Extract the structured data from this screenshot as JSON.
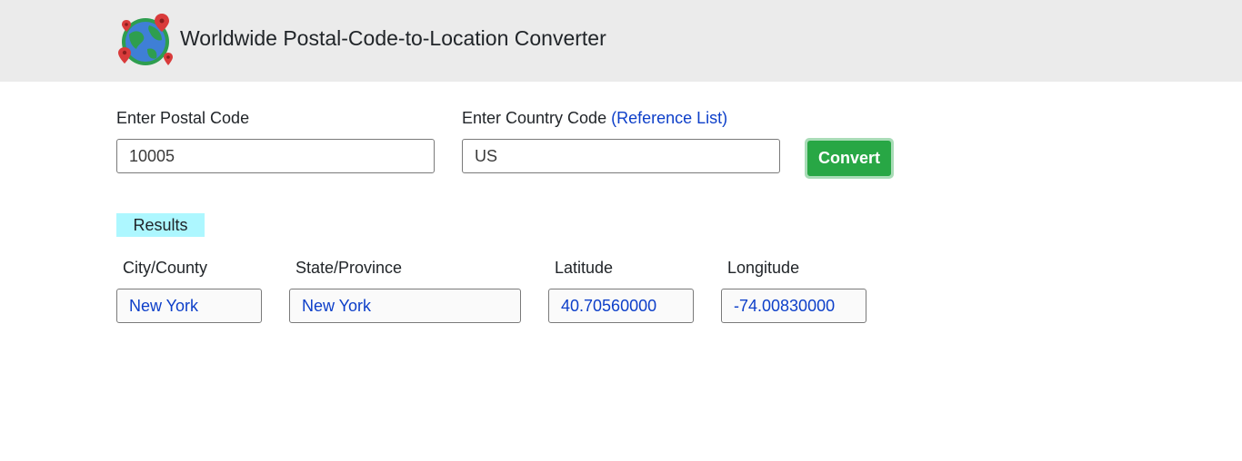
{
  "header": {
    "title": "Worldwide Postal-Code-to-Location Converter",
    "logo_icon": "globe-with-pins-icon"
  },
  "form": {
    "postal_code_label": "Enter Postal Code",
    "postal_code_value": "10005",
    "country_code_label": "Enter Country Code",
    "reference_link": "(Reference List)",
    "country_code_value": "US",
    "convert_button": "Convert"
  },
  "results": {
    "badge": "Results",
    "city_label": "City/County",
    "city_value": "New York",
    "state_label": "State/Province",
    "state_value": "New York",
    "latitude_label": "Latitude",
    "latitude_value": "40.70560000",
    "longitude_label": "Longitude",
    "longitude_value": "-74.00830000"
  },
  "colors": {
    "header_bg": "#ebebeb",
    "button_green": "#28a745",
    "results_badge_bg": "#adf7ff",
    "link_blue": "#0d3fc9"
  }
}
